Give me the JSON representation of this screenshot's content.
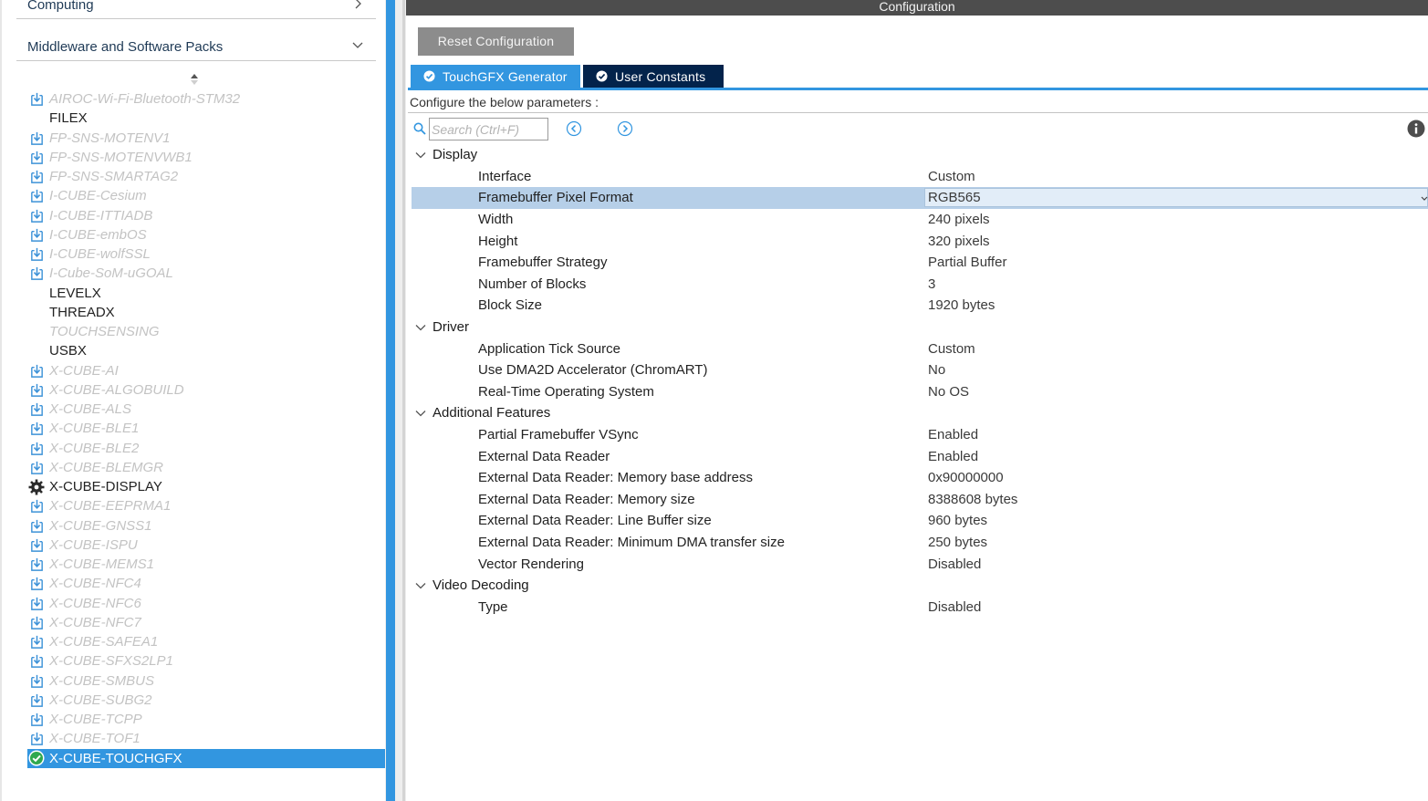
{
  "left": {
    "categories": [
      {
        "label": "Computing",
        "icon": "chevron-right-icon"
      },
      {
        "label": "Middleware and Software Packs",
        "icon": "chevron-down-icon"
      }
    ],
    "packs": [
      {
        "label": "AIROC-Wi-Fi-Bluetooth-STM32",
        "state": "disabled",
        "icon": "pack-download-icon"
      },
      {
        "label": "FILEX",
        "state": "normal",
        "icon": ""
      },
      {
        "label": "FP-SNS-MOTENV1",
        "state": "disabled",
        "icon": "pack-download-icon"
      },
      {
        "label": "FP-SNS-MOTENVWB1",
        "state": "disabled",
        "icon": "pack-download-icon"
      },
      {
        "label": "FP-SNS-SMARTAG2",
        "state": "disabled",
        "icon": "pack-download-icon"
      },
      {
        "label": "I-CUBE-Cesium",
        "state": "disabled",
        "icon": "pack-download-icon"
      },
      {
        "label": "I-CUBE-ITTIADB",
        "state": "disabled",
        "icon": "pack-download-icon"
      },
      {
        "label": "I-CUBE-embOS",
        "state": "disabled",
        "icon": "pack-download-icon"
      },
      {
        "label": "I-CUBE-wolfSSL",
        "state": "disabled",
        "icon": "pack-download-icon"
      },
      {
        "label": "I-Cube-SoM-uGOAL",
        "state": "disabled",
        "icon": "pack-download-icon"
      },
      {
        "label": "LEVELX",
        "state": "normal",
        "icon": ""
      },
      {
        "label": "THREADX",
        "state": "normal",
        "icon": ""
      },
      {
        "label": "TOUCHSENSING",
        "state": "disabled",
        "icon": ""
      },
      {
        "label": "USBX",
        "state": "normal",
        "icon": ""
      },
      {
        "label": "X-CUBE-AI",
        "state": "disabled",
        "icon": "pack-download-icon"
      },
      {
        "label": "X-CUBE-ALGOBUILD",
        "state": "disabled",
        "icon": "pack-download-icon"
      },
      {
        "label": "X-CUBE-ALS",
        "state": "disabled",
        "icon": "pack-download-icon"
      },
      {
        "label": "X-CUBE-BLE1",
        "state": "disabled",
        "icon": "pack-download-icon"
      },
      {
        "label": "X-CUBE-BLE2",
        "state": "disabled",
        "icon": "pack-download-icon"
      },
      {
        "label": "X-CUBE-BLEMGR",
        "state": "disabled",
        "icon": "pack-download-icon"
      },
      {
        "label": "X-CUBE-DISPLAY",
        "state": "normal",
        "icon": "gear-icon"
      },
      {
        "label": "X-CUBE-EEPRMA1",
        "state": "disabled",
        "icon": "pack-download-icon"
      },
      {
        "label": "X-CUBE-GNSS1",
        "state": "disabled",
        "icon": "pack-download-icon"
      },
      {
        "label": "X-CUBE-ISPU",
        "state": "disabled",
        "icon": "pack-download-icon"
      },
      {
        "label": "X-CUBE-MEMS1",
        "state": "disabled",
        "icon": "pack-download-icon"
      },
      {
        "label": "X-CUBE-NFC4",
        "state": "disabled",
        "icon": "pack-download-icon"
      },
      {
        "label": "X-CUBE-NFC6",
        "state": "disabled",
        "icon": "pack-download-icon"
      },
      {
        "label": "X-CUBE-NFC7",
        "state": "disabled",
        "icon": "pack-download-icon"
      },
      {
        "label": "X-CUBE-SAFEA1",
        "state": "disabled",
        "icon": "pack-download-icon"
      },
      {
        "label": "X-CUBE-SFXS2LP1",
        "state": "disabled",
        "icon": "pack-download-icon"
      },
      {
        "label": "X-CUBE-SMBUS",
        "state": "disabled",
        "icon": "pack-download-icon"
      },
      {
        "label": "X-CUBE-SUBG2",
        "state": "disabled",
        "icon": "pack-download-icon"
      },
      {
        "label": "X-CUBE-TCPP",
        "state": "disabled",
        "icon": "pack-download-icon"
      },
      {
        "label": "X-CUBE-TOF1",
        "state": "disabled",
        "icon": "pack-download-icon"
      },
      {
        "label": "X-CUBE-TOUCHGFX",
        "state": "selected",
        "icon": "check-circle-icon"
      }
    ]
  },
  "right": {
    "title": "Configuration",
    "reset_label": "Reset Configuration",
    "tabs": [
      {
        "label": "TouchGFX Generator",
        "active": true
      },
      {
        "label": "User Constants",
        "active": false
      }
    ],
    "configure_label": "Configure the below parameters :",
    "search": {
      "placeholder": "Search (Ctrl+F)",
      "value": ""
    },
    "groups": [
      {
        "label": "Display",
        "params": [
          {
            "name": "Interface",
            "value": "Custom"
          },
          {
            "name": "Framebuffer Pixel Format",
            "value": "RGB565",
            "selected": true
          },
          {
            "name": "Width",
            "value": "240 pixels"
          },
          {
            "name": "Height",
            "value": "320 pixels"
          },
          {
            "name": "Framebuffer Strategy",
            "value": "Partial Buffer"
          },
          {
            "name": "Number of Blocks",
            "value": "3"
          },
          {
            "name": "Block Size",
            "value": "1920 bytes"
          }
        ]
      },
      {
        "label": "Driver",
        "params": [
          {
            "name": "Application Tick Source",
            "value": "Custom"
          },
          {
            "name": "Use DMA2D Accelerator (ChromART)",
            "value": "No"
          },
          {
            "name": "Real-Time Operating System",
            "value": "No OS"
          }
        ]
      },
      {
        "label": "Additional Features",
        "params": [
          {
            "name": "Partial Framebuffer VSync",
            "value": "Enabled"
          },
          {
            "name": "External Data Reader",
            "value": "Enabled"
          },
          {
            "name": "External Data Reader: Memory base address",
            "value": "0x90000000"
          },
          {
            "name": "External Data Reader: Memory size",
            "value": "8388608 bytes"
          },
          {
            "name": "External Data Reader: Line Buffer size",
            "value": "960 bytes"
          },
          {
            "name": "External Data Reader: Minimum DMA transfer size",
            "value": "250 bytes"
          },
          {
            "name": "Vector Rendering",
            "value": "Disabled"
          }
        ]
      },
      {
        "label": "Video Decoding",
        "params": [
          {
            "name": "Type",
            "value": "Disabled"
          }
        ]
      }
    ]
  },
  "colors": {
    "accent": "#3296e0",
    "dark_tab": "#03234b",
    "title_bar": "#4d4d4d",
    "selected_row": "#b6cfe8",
    "disabled_text": "#c3c3c3",
    "category_text": "#1f3a56"
  }
}
